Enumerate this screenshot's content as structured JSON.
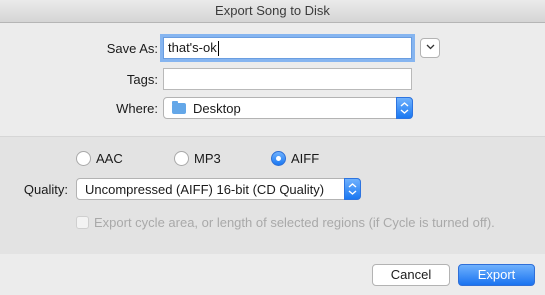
{
  "window": {
    "title": "Export Song to Disk"
  },
  "form": {
    "save_as_label": "Save As:",
    "save_as_value": "that's-ok",
    "tags_label": "Tags:",
    "tags_value": "",
    "where_label": "Where:",
    "where_value": "Desktop",
    "expand_icon": "chevron-down-icon",
    "folder_icon": "folder-icon"
  },
  "format": {
    "options": [
      {
        "label": "AAC",
        "selected": false
      },
      {
        "label": "MP3",
        "selected": false
      },
      {
        "label": "AIFF",
        "selected": true
      }
    ]
  },
  "quality": {
    "label": "Quality:",
    "value": "Uncompressed (AIFF) 16-bit (CD Quality)"
  },
  "cycle_option": {
    "label": "Export cycle area, or length of selected regions (if Cycle is turned off).",
    "checked": false,
    "enabled": false
  },
  "buttons": {
    "cancel": "Cancel",
    "export": "Export"
  },
  "colors": {
    "accent": "#1a78f2",
    "focus_ring": "#86b5f0"
  }
}
